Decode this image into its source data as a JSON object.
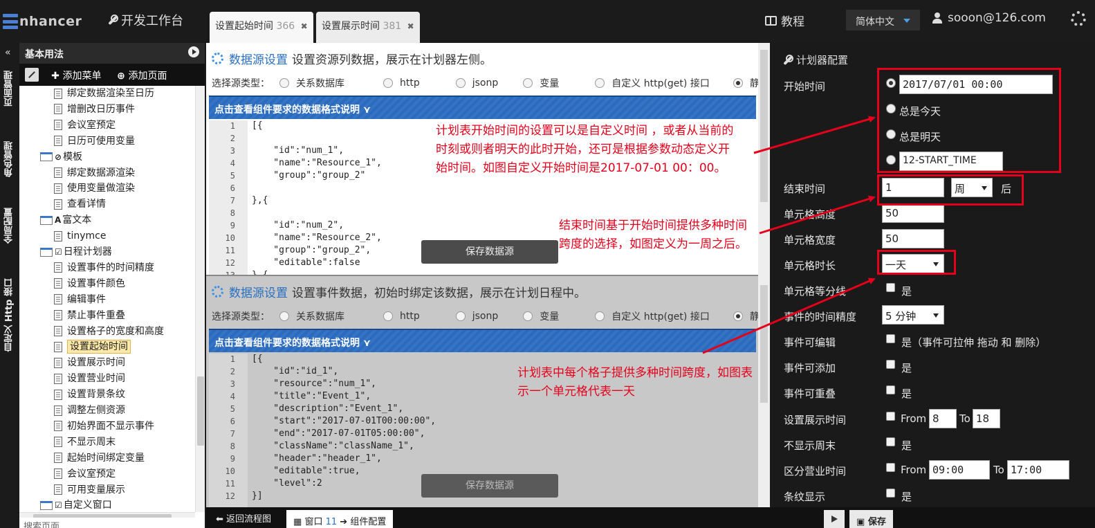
{
  "top": {
    "logo": "nhancer",
    "devbench": "开发工作台",
    "tabs": [
      {
        "label": "设置起始时间",
        "num": "366"
      },
      {
        "label": "设置展示时间",
        "num": "381"
      }
    ],
    "close_glyph": "✖",
    "tutorial": "教程",
    "language": "简体中文",
    "user": "sooon@126.com"
  },
  "side_tabs": [
    "页面管理",
    "角色管理",
    "全局配置",
    "自定义 Http 接口"
  ],
  "left_panel": {
    "title": "基本用法",
    "add_menu": "添加菜单",
    "add_page": "添加页面",
    "search_placeholder": "搜索页面",
    "tree": [
      {
        "label": "绑定数据渲染至日历",
        "kind": "doc",
        "level": 2
      },
      {
        "label": "增删改日历事件",
        "kind": "doc",
        "level": 2
      },
      {
        "label": "会议室预定",
        "kind": "doc",
        "level": 2
      },
      {
        "label": "日历可使用变量",
        "kind": "doc",
        "level": 2
      },
      {
        "label": "模板",
        "kind": "folder",
        "glyph": "⊘",
        "level": 1
      },
      {
        "label": "绑定数据源渲染",
        "kind": "doc",
        "level": 2
      },
      {
        "label": "使用变量做渲染",
        "kind": "doc",
        "level": 2
      },
      {
        "label": "查看详情",
        "kind": "doc",
        "level": 2
      },
      {
        "label": "富文本",
        "kind": "folder",
        "glyph": "A",
        "level": 1
      },
      {
        "label": "tinymce",
        "kind": "doc",
        "level": 2
      },
      {
        "label": "日程计划器",
        "kind": "folder",
        "glyph": "☑",
        "level": 1
      },
      {
        "label": "设置事件的时间精度",
        "kind": "doc",
        "level": 2
      },
      {
        "label": "设置事件颜色",
        "kind": "doc",
        "level": 2
      },
      {
        "label": "编辑事件",
        "kind": "doc",
        "level": 2
      },
      {
        "label": "禁止事件重叠",
        "kind": "doc",
        "level": 2
      },
      {
        "label": "设置格子的宽度和高度",
        "kind": "doc",
        "level": 2
      },
      {
        "label": "设置起始时间",
        "kind": "doc",
        "level": 2,
        "selected": true
      },
      {
        "label": "设置展示时间",
        "kind": "doc",
        "level": 2
      },
      {
        "label": "设置营业时间",
        "kind": "doc",
        "level": 2
      },
      {
        "label": "设置背景条纹",
        "kind": "doc",
        "level": 2
      },
      {
        "label": "调整左侧资源",
        "kind": "doc",
        "level": 2
      },
      {
        "label": "初始界面不显示事件",
        "kind": "doc",
        "level": 2
      },
      {
        "label": "不显示周末",
        "kind": "doc",
        "level": 2
      },
      {
        "label": "起始时间绑定变量",
        "kind": "doc",
        "level": 2
      },
      {
        "label": "会议室预定",
        "kind": "doc",
        "level": 2
      },
      {
        "label": "可用变量展示",
        "kind": "doc",
        "level": 2
      },
      {
        "label": "自定义窗口",
        "kind": "folder",
        "glyph": "☑",
        "level": 1
      }
    ]
  },
  "datasource1": {
    "title": "数据源设置",
    "desc": "设置资源列数据，展示在计划器左侧。",
    "type_label": "选择源类型：",
    "types": [
      "关系数据库",
      "http",
      "jsonp",
      "变量",
      "自定义 http(get) 接口",
      "静态数据"
    ],
    "selected": 5,
    "format_bar": "点击查看组件要求的数据格式说明 ⋎",
    "save": "保存数据源",
    "code": [
      "[{",
      "",
      "    \"id\":\"num_1\",",
      "    \"name\":\"Resource_1\",",
      "    \"group\":\"group_2\"",
      "",
      "},{",
      "",
      "    \"id\":\"num_2\",",
      "    \"name\":\"Resource_2\",",
      "    \"group\":\"group_2\",",
      "    \"editable\":false",
      "},{"
    ]
  },
  "datasource2": {
    "title": "数据源设置",
    "desc": "设置事件数据，初始时绑定该数据，展示在计划日程中。",
    "type_label": "选择源类型：",
    "types": [
      "关系数据库",
      "http",
      "jsonp",
      "变量",
      "自定义 http(get) 接口",
      "静态数据"
    ],
    "selected": 5,
    "format_bar": "点击查看组件要求的数据格式说明 ⋎",
    "save": "保存数据源",
    "code": [
      "[{",
      "    \"id\":\"id_1\",",
      "    \"resource\":\"num_1\",",
      "    \"title\":\"Event_1\",",
      "    \"description\":\"Event_1\",",
      "    \"start\":\"2017-07-01T00:00:00\",",
      "    \"end\":\"2017-07-01T05:00:00\",",
      "    \"className\":\"className_1\",",
      "    \"header\":\"header_1\",",
      "    \"editable\":true,",
      "    \"level\":2",
      "}]"
    ]
  },
  "bottom_bar": {
    "back": "返回流程图",
    "window": "窗口",
    "window_num": "11",
    "component_config": "组件配置",
    "save": "保存"
  },
  "config": {
    "title": "计划器配置",
    "start_time_label": "开始时间",
    "start_time_value": "2017/07/01 00:00",
    "always_today": "总是今天",
    "always_tomorrow": "总是明天",
    "variable_value": "12-START_TIME",
    "end_time_label": "结束时间",
    "end_time_amount": "1",
    "end_time_unit": "周",
    "end_time_suffix": "后",
    "cell_height_label": "单元格高度",
    "cell_height": "50",
    "cell_width_label": "单元格宽度",
    "cell_width": "50",
    "cell_duration_label": "单元格时长",
    "cell_duration": "一天",
    "cell_divider_label": "单元格等分线",
    "yes": "是",
    "precision_label": "事件的时间精度",
    "precision": "5 分钟",
    "editable_label": "事件可编辑",
    "editable_note": "是（事件可拉伸 拖动 和 删除）",
    "addable_label": "事件可添加",
    "overlap_label": "事件可重叠",
    "display_time_label": "设置展示时间",
    "from": "From",
    "to": "To",
    "display_from": "8",
    "display_to": "18",
    "no_weekend_label": "不显示周末",
    "business_label": "区分营业时间",
    "business_from": "09:00",
    "business_to": "17:00",
    "stripe_label": "条纹显示"
  },
  "annotations": {
    "a1": "计划表开始时间的设置可以是自定义时间 ，或者从当前的时刻或则者明天的此时开始，还可是根据参数动态定义开始时间。如图自定义开始时间是2017-07-01 00：00。",
    "a2": "结束时间基于开始时间提供多种时间跨度的选择，如图定义为一周之后。",
    "a3": "计划表中每个格子提供多种时间跨度，如图表示一个单元格代表一天"
  },
  "colors": {
    "annotation_red": "#e4001b",
    "accent_blue": "#2a6bbf"
  }
}
